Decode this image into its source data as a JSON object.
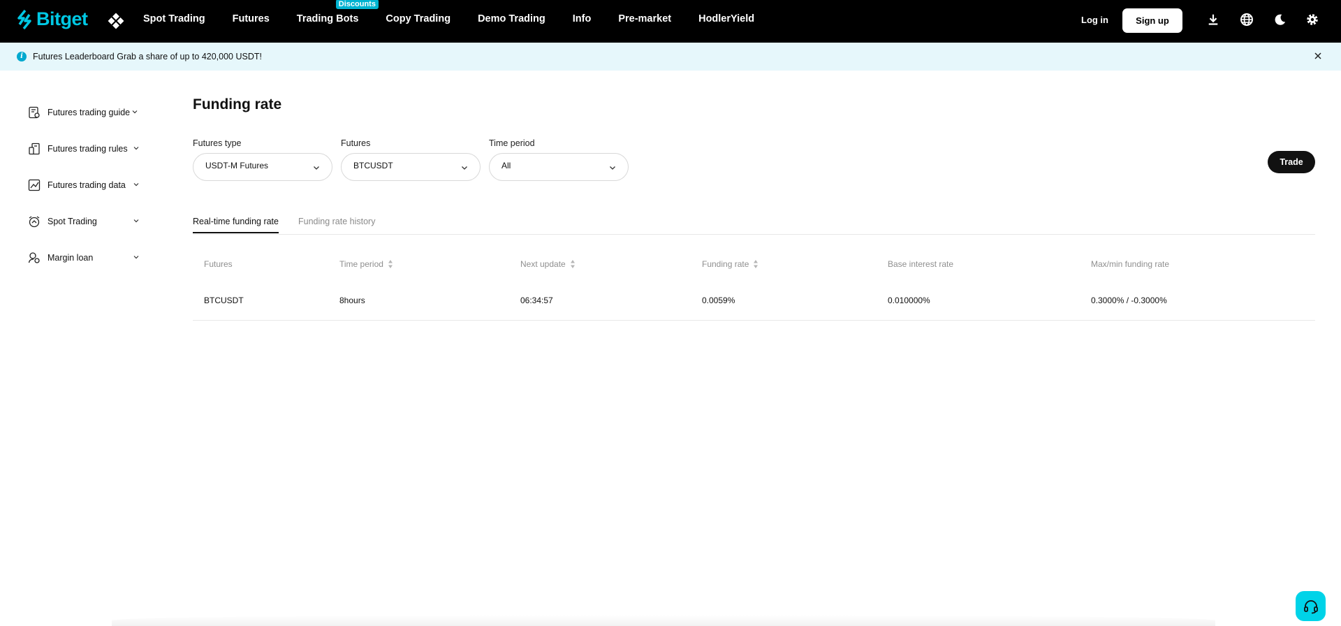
{
  "brand": {
    "name": "Bitget",
    "accent": "#00c8e4"
  },
  "nav": {
    "items": [
      {
        "label": "Spot Trading"
      },
      {
        "label": "Futures"
      },
      {
        "label": "Trading Bots",
        "badge": "Discounts"
      },
      {
        "label": "Copy Trading"
      },
      {
        "label": "Demo Trading"
      },
      {
        "label": "Info"
      },
      {
        "label": "Pre-market"
      },
      {
        "label": "HodlerYield"
      }
    ],
    "login": "Log in",
    "signup": "Sign up",
    "icons": [
      "download-icon",
      "globe-icon",
      "moon-icon",
      "gear-icon"
    ]
  },
  "announcement": {
    "text": "Futures Leaderboard Grab a share of up to 420,000 USDT!"
  },
  "sidebar": {
    "items": [
      {
        "label": "Futures trading guide",
        "icon": "guide-icon"
      },
      {
        "label": "Futures trading rules",
        "icon": "rules-icon"
      },
      {
        "label": "Futures trading data",
        "icon": "chart-icon"
      },
      {
        "label": "Spot Trading",
        "icon": "spot-icon"
      },
      {
        "label": "Margin loan",
        "icon": "loan-icon"
      }
    ]
  },
  "page": {
    "title": "Funding rate",
    "trade_label": "Trade"
  },
  "filters": {
    "futures_type": {
      "label": "Futures type",
      "value": "USDT-M Futures"
    },
    "futures": {
      "label": "Futures",
      "value": "BTCUSDT"
    },
    "time_period": {
      "label": "Time period",
      "value": "All"
    }
  },
  "tabs": [
    {
      "label": "Real-time funding rate",
      "active": true
    },
    {
      "label": "Funding rate history",
      "active": false
    }
  ],
  "table": {
    "headers": [
      "Futures",
      "Time period",
      "Next update",
      "Funding rate",
      "Base interest rate",
      "Max/min funding rate"
    ],
    "rows": [
      [
        "BTCUSDT",
        "8hours",
        "06:34:57",
        "0.0059%",
        "0.010000%",
        "0.3000% / -0.3000%"
      ]
    ]
  }
}
